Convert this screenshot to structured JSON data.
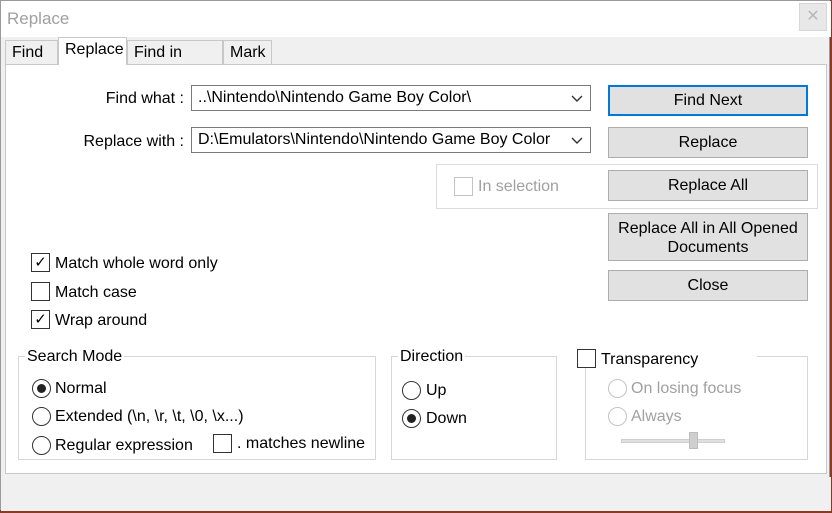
{
  "window": {
    "title": "Replace",
    "close_glyph": "✕"
  },
  "tabs": [
    {
      "label": "Find"
    },
    {
      "label": "Replace"
    },
    {
      "label": "Find in Files"
    },
    {
      "label": "Mark"
    }
  ],
  "find_what": {
    "label": "Find what :",
    "value": "..\\Nintendo\\Nintendo Game Boy Color\\"
  },
  "replace_with": {
    "label": "Replace with :",
    "value": "D:\\Emulators\\Nintendo\\Nintendo Game Boy Color"
  },
  "buttons": {
    "find_next": "Find Next",
    "replace": "Replace",
    "replace_all": "Replace All",
    "replace_all_opened_line1": "Replace All in All Opened",
    "replace_all_opened_line2": "Documents",
    "close": "Close"
  },
  "in_selection": {
    "label": "In selection",
    "checked": false,
    "enabled": false
  },
  "options": {
    "match_whole_word": {
      "label": "Match whole word only",
      "checked": true
    },
    "match_case": {
      "label": "Match case",
      "checked": false
    },
    "wrap_around": {
      "label": "Wrap around",
      "checked": true
    }
  },
  "search_mode": {
    "title": "Search Mode",
    "normal": "Normal",
    "extended": "Extended (\\n, \\r, \\t, \\0, \\x...)",
    "regex": "Regular expression",
    "matches_newline": ". matches newline",
    "selected": "Normal"
  },
  "direction": {
    "title": "Direction",
    "up": "Up",
    "down": "Down",
    "selected": "Down"
  },
  "transparency": {
    "label": "Transparency",
    "checked": false,
    "on_losing_focus": "On losing focus",
    "always": "Always"
  },
  "icons": {
    "check": "✓",
    "chevron": "chevron-down-icon"
  }
}
